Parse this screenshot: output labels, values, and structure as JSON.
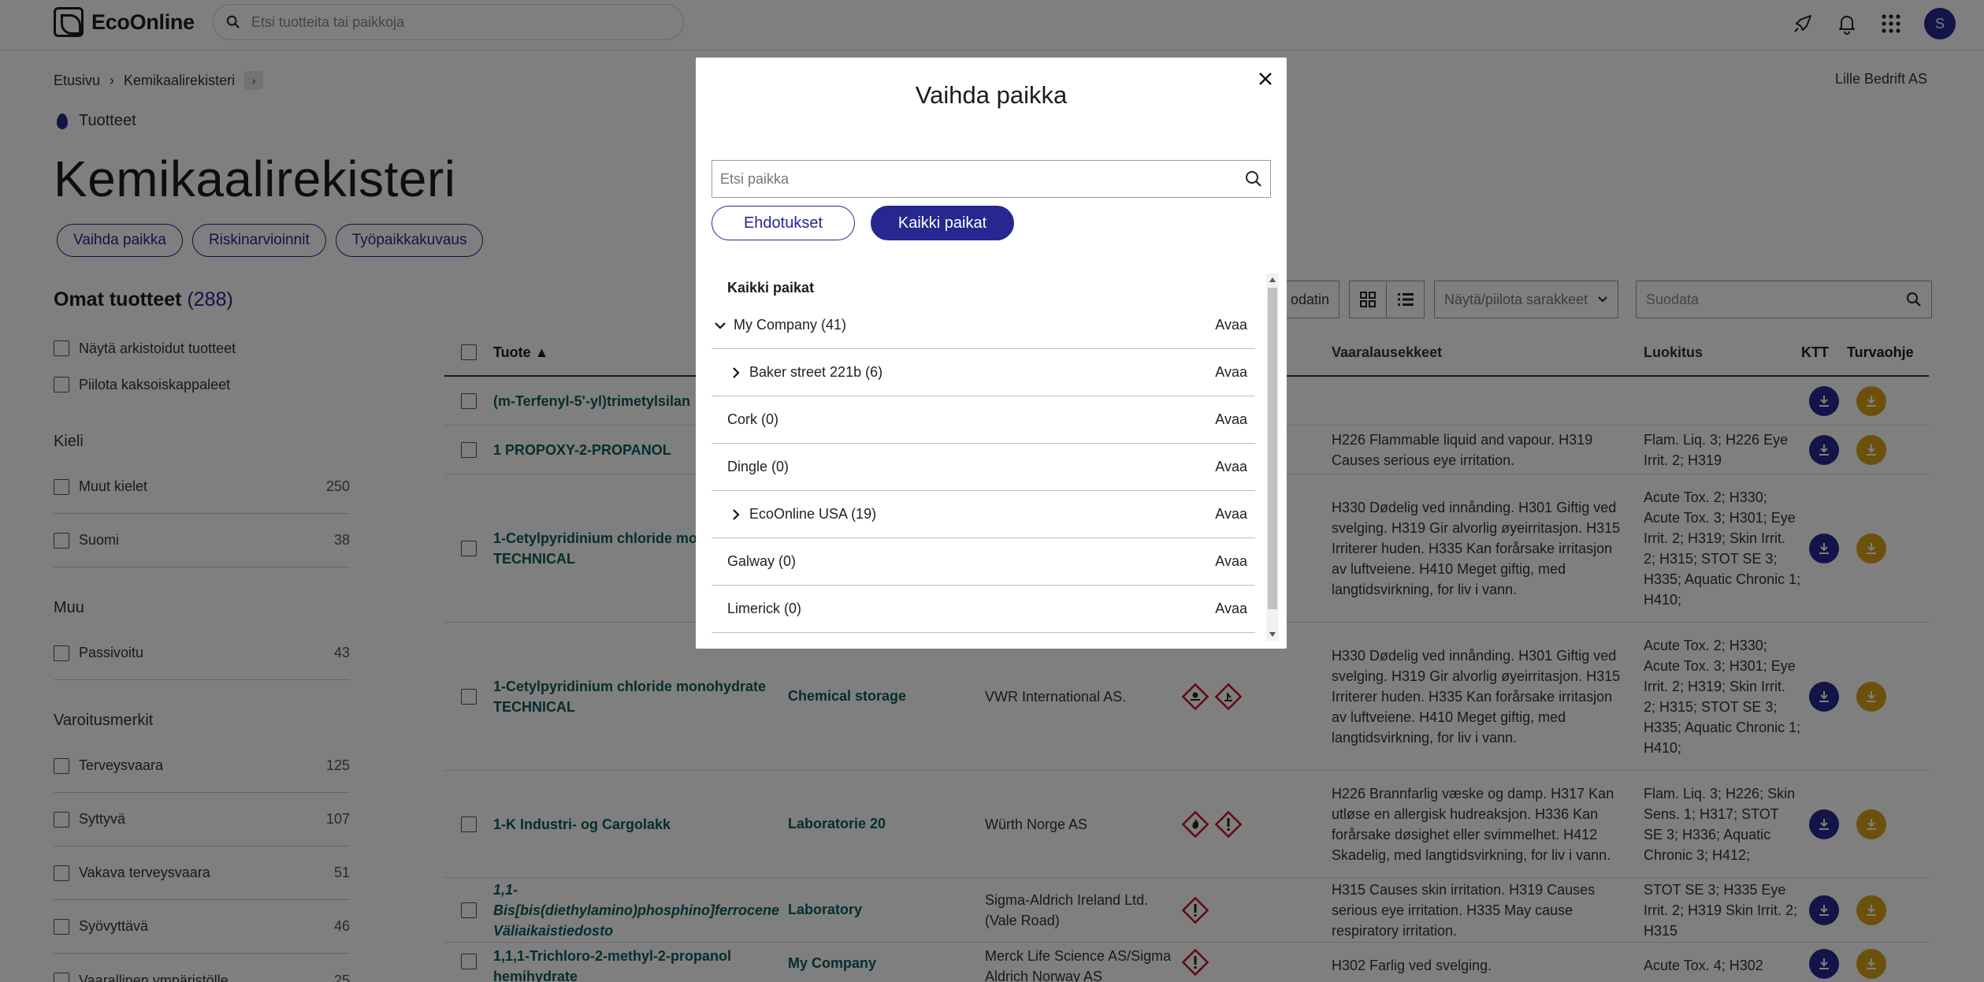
{
  "header": {
    "brand": "EcoOnline",
    "search_placeholder": "Etsi tuotteita tai paikkoja",
    "avatar_initial": "S"
  },
  "breadcrumb": {
    "home": "Etusivu",
    "current": "Kemikaalirekisteri"
  },
  "company": "Lille Bedrift AS",
  "products_link": "Tuotteet",
  "page_title": "Kemikaalirekisteri",
  "page_actions": [
    "Vaihda paikka",
    "Riskinarvioinnit",
    "Työpaikkakuvaus"
  ],
  "sidebar": {
    "title": "Omat tuotteet",
    "count": "(288)",
    "options": [
      "Näytä arkistoidut tuotteet",
      "Piilota kaksoiskappaleet"
    ],
    "groups": [
      {
        "title": "Kieli",
        "items": [
          {
            "label": "Muut kielet",
            "count": "250"
          },
          {
            "label": "Suomi",
            "count": "38"
          }
        ]
      },
      {
        "title": "Muu",
        "items": [
          {
            "label": "Passivoitu",
            "count": "43"
          }
        ]
      },
      {
        "title": "Varoitusmerkit",
        "items": [
          {
            "label": "Terveysvaara",
            "count": "125"
          },
          {
            "label": "Syttyvä",
            "count": "107"
          },
          {
            "label": "Vakava terveysvaara",
            "count": "51"
          },
          {
            "label": "Syövyttävä",
            "count": "46"
          },
          {
            "label": "Vaarallinen ympäristölle",
            "count": "25"
          }
        ]
      }
    ]
  },
  "toolbar": {
    "button_partial": "odatin",
    "columns_toggle": "Näytä/piilota sarakkeet",
    "filter_placeholder": "Suodata"
  },
  "table": {
    "headers": {
      "product": "Tuote ▲",
      "hazard": "Vaaralausekkeet",
      "classification": "Luokitus",
      "ktt": "KTT",
      "safety": "Turvaohje"
    },
    "rows": [
      {
        "product": "(m-Terfenyl-5'-yl)trimetylsilan",
        "location": "",
        "supplier": "",
        "symbols": [],
        "hazard": "",
        "classification": ""
      },
      {
        "product": "1 PROPOXY-2-PROPANOL",
        "location": "",
        "supplier": "",
        "symbols": [],
        "hazard": "H226 Flammable liquid and vapour. H319 Causes serious eye irritation.",
        "classification": "Flam. Liq. 3; H226 Eye Irrit. 2; H319"
      },
      {
        "product": "1-Cetylpyridinium chloride monohydrate TECHNICAL",
        "location": "",
        "supplier": "",
        "symbols": [],
        "hazard": "H330 Dødelig ved innånding. H301 Giftig ved svelging. H319 Gir alvorlig øyeirritasjon. H315 Irriterer huden. H335 Kan forårsake irritasjon av luftveiene. H410 Meget giftig, med langtidsvirkning, for liv i vann.",
        "classification": "Acute Tox. 2; H330; Acute Tox. 3; H301; Eye Irrit. 2; H319; Skin Irrit. 2; H315; STOT SE 3; H335; Aquatic Chronic 1; H410;"
      },
      {
        "product": "1-Cetylpyridinium chloride monohydrate TECHNICAL",
        "location": "Chemical storage",
        "supplier": "VWR International AS.",
        "symbols": [
          "toxic-icon",
          "environment-icon"
        ],
        "hazard": "H330 Dødelig ved innånding. H301 Giftig ved svelging. H319 Gir alvorlig øyeirritasjon. H315 Irriterer huden. H335 Kan forårsake irritasjon av luftveiene. H410 Meget giftig, med langtidsvirkning, for liv i vann.",
        "classification": "Acute Tox. 2; H330; Acute Tox. 3; H301; Eye Irrit. 2; H319; Skin Irrit. 2; H315; STOT SE 3; H335; Aquatic Chronic 1; H410;"
      },
      {
        "product": "1-K Industri- og Cargolakk",
        "location": "Laboratorie 20",
        "supplier": "Würth Norge AS",
        "symbols": [
          "flame-icon",
          "exclamation-icon"
        ],
        "hazard": "H226 Brannfarlig væske og damp. H317 Kan utløse en allergisk hudreaksjon. H336 Kan forårsake døsighet eller svimmelhet. H412 Skadelig, med langtidsvirkning, for liv i vann.",
        "classification": "Flam. Liq. 3; H226; Skin Sens. 1; H317; STOT SE 3; H336; Aquatic Chronic 3; H412;"
      },
      {
        "product": "1,1-Bis[bis(diethylamino)phosphino]ferrocene",
        "product_sub": "Väliaikaistiedosto",
        "location": "Laboratory",
        "supplier": "Sigma-Aldrich Ireland Ltd. (Vale Road)",
        "symbols": [
          "exclamation-icon"
        ],
        "hazard": "H315 Causes skin irritation. H319 Causes serious eye irritation. H335 May cause respiratory irritation.",
        "classification": "STOT SE 3; H335 Eye Irrit. 2; H319 Skin Irrit. 2; H315"
      },
      {
        "product": "1,1,1-Trichloro-2-methyl-2-propanol hemihydrate",
        "location": "My Company",
        "supplier": "Merck Life Science AS/Sigma Aldrich Norway AS",
        "symbols": [
          "exclamation-icon"
        ],
        "hazard": "H302 Farlig ved svelging.",
        "classification": "Acute Tox. 4; H302"
      }
    ]
  },
  "modal": {
    "title": "Vaihda paikka",
    "search_placeholder": "Etsi paikka",
    "tab_suggestions": "Ehdotukset",
    "tab_all": "Kaikki paikat",
    "list_header": "Kaikki paikat",
    "open_label": "Avaa",
    "locations": [
      {
        "name": "My Company (41)",
        "level": 0,
        "expander": "expanded"
      },
      {
        "name": "Baker street 221b (6)",
        "level": 1,
        "expander": "collapsed"
      },
      {
        "name": "Cork (0)",
        "level": 1,
        "expander": "none"
      },
      {
        "name": "Dingle (0)",
        "level": 1,
        "expander": "none"
      },
      {
        "name": "EcoOnline USA (19)",
        "level": 1,
        "expander": "collapsed"
      },
      {
        "name": "Galway (0)",
        "level": 1,
        "expander": "none"
      },
      {
        "name": "Limerick (0)",
        "level": 1,
        "expander": "none"
      }
    ]
  },
  "colors": {
    "primary": "#26288f",
    "gold": "#d9a21b",
    "link": "#0d5b5b",
    "hazard_red": "#c8102e"
  }
}
